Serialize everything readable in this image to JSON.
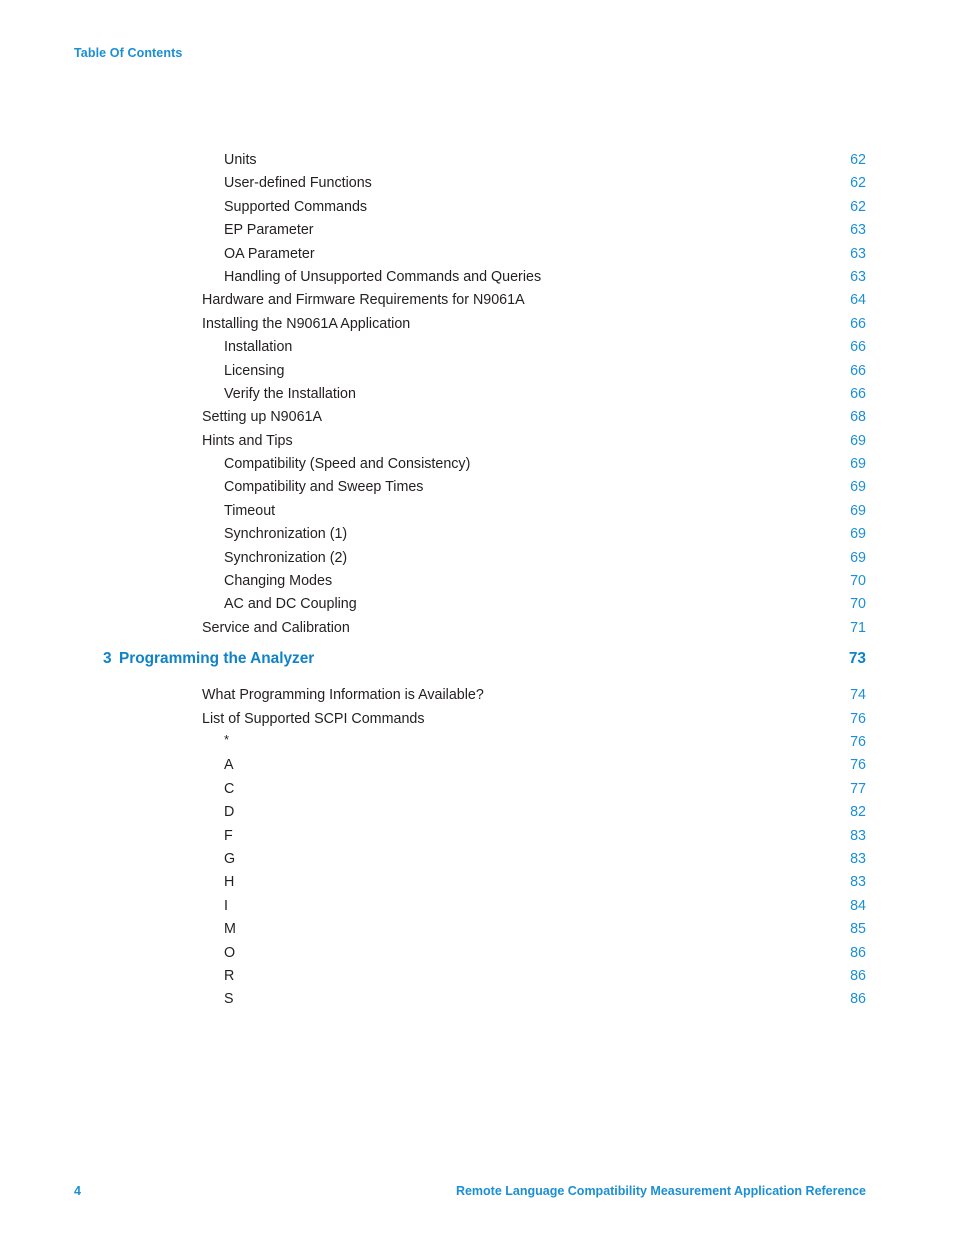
{
  "header": {
    "running_title": "Table Of Contents"
  },
  "colors": {
    "accent_blue": "#1b8fd4",
    "chapter_blue": "#0f82c8",
    "body_text": "#231f20"
  },
  "toc": {
    "entries": [
      {
        "level": 2,
        "title": "Units",
        "page": "62"
      },
      {
        "level": 2,
        "title": "User-defined Functions",
        "page": "62"
      },
      {
        "level": 2,
        "title": "Supported Commands",
        "page": "62"
      },
      {
        "level": 2,
        "title": "EP Parameter",
        "page": "63"
      },
      {
        "level": 2,
        "title": "OA Parameter",
        "page": "63"
      },
      {
        "level": 2,
        "title": "Handling of Unsupported Commands and Queries",
        "page": "63"
      },
      {
        "level": 1,
        "title": "Hardware and Firmware Requirements for N9061A",
        "page": "64"
      },
      {
        "level": 1,
        "title": "Installing the N9061A Application",
        "page": "66"
      },
      {
        "level": 2,
        "title": "Installation",
        "page": "66"
      },
      {
        "level": 2,
        "title": "Licensing",
        "page": "66"
      },
      {
        "level": 2,
        "title": "Verify the Installation",
        "page": "66"
      },
      {
        "level": 1,
        "title": "Setting up N9061A",
        "page": "68"
      },
      {
        "level": 1,
        "title": "Hints and Tips",
        "page": "69"
      },
      {
        "level": 2,
        "title": "Compatibility (Speed and Consistency)",
        "page": "69"
      },
      {
        "level": 2,
        "title": "Compatibility and Sweep Times",
        "page": "69"
      },
      {
        "level": 2,
        "title": "Timeout",
        "page": "69"
      },
      {
        "level": 2,
        "title": "Synchronization (1)",
        "page": "69"
      },
      {
        "level": 2,
        "title": "Synchronization (2)",
        "page": "69"
      },
      {
        "level": 2,
        "title": "Changing Modes",
        "page": "70"
      },
      {
        "level": 2,
        "title": "AC and DC Coupling",
        "page": "70"
      },
      {
        "level": 1,
        "title": "Service and Calibration",
        "page": "71"
      },
      {
        "level": 0,
        "number": "3",
        "title": "Programming the Analyzer",
        "page": "73"
      },
      {
        "level": 1,
        "title": "What Programming Information is Available?",
        "page": "74"
      },
      {
        "level": 1,
        "title": "List of Supported SCPI Commands",
        "page": "76"
      },
      {
        "level": 2,
        "title": "*",
        "page": "76",
        "star": true
      },
      {
        "level": 2,
        "title": "A",
        "page": "76"
      },
      {
        "level": 2,
        "title": "C",
        "page": "77"
      },
      {
        "level": 2,
        "title": "D",
        "page": "82"
      },
      {
        "level": 2,
        "title": "F",
        "page": "83"
      },
      {
        "level": 2,
        "title": "G",
        "page": "83"
      },
      {
        "level": 2,
        "title": "H",
        "page": "83"
      },
      {
        "level": 2,
        "title": "I",
        "page": "84"
      },
      {
        "level": 2,
        "title": "M",
        "page": "85"
      },
      {
        "level": 2,
        "title": "O",
        "page": "86"
      },
      {
        "level": 2,
        "title": "R",
        "page": "86"
      },
      {
        "level": 2,
        "title": "S",
        "page": "86"
      }
    ]
  },
  "footer": {
    "folio": "4",
    "book_title": "Remote Language Compatibility Measurement Application Reference"
  }
}
